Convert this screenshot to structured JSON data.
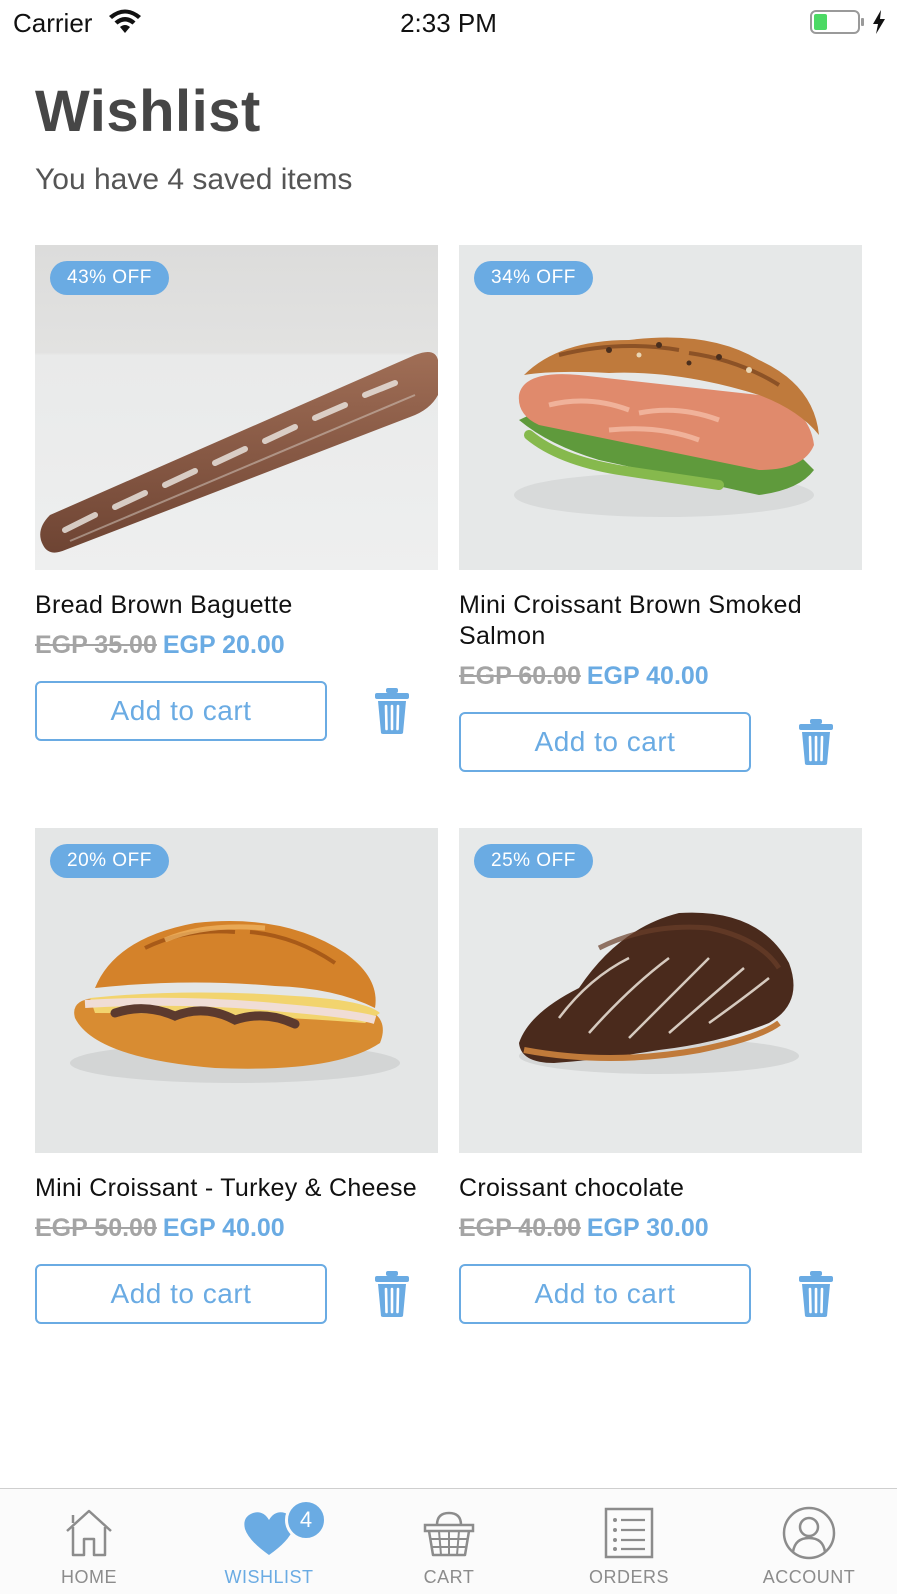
{
  "status_bar": {
    "carrier": "Carrier",
    "time": "2:33 PM"
  },
  "header": {
    "title": "Wishlist",
    "subtitle": "You have 4 saved items"
  },
  "items": [
    {
      "discount": "43% OFF",
      "name": "Bread Brown Baguette",
      "old_price": "EGP 35.00",
      "new_price": "EGP 20.00",
      "add_label": "Add to cart"
    },
    {
      "discount": "34% OFF",
      "name": "Mini Croissant Brown Smoked Salmon",
      "old_price": "EGP 60.00",
      "new_price": "EGP 40.00",
      "add_label": "Add to cart"
    },
    {
      "discount": "20% OFF",
      "name": "Mini Croissant - Turkey & Cheese",
      "old_price": "EGP 50.00",
      "new_price": "EGP 40.00",
      "add_label": "Add to cart"
    },
    {
      "discount": "25% OFF",
      "name": "Croissant chocolate",
      "old_price": "EGP 40.00",
      "new_price": "EGP 30.00",
      "add_label": "Add to cart"
    }
  ],
  "tab_bar": {
    "tabs": [
      {
        "label": "HOME",
        "icon": "home-icon"
      },
      {
        "label": "WISHLIST",
        "icon": "heart-icon",
        "badge": "4",
        "active": true
      },
      {
        "label": "CART",
        "icon": "basket-icon"
      },
      {
        "label": "ORDERS",
        "icon": "list-icon"
      },
      {
        "label": "ACCOUNT",
        "icon": "user-icon"
      }
    ]
  },
  "colors": {
    "accent": "#6aabe3",
    "title": "#464646",
    "strike_price": "#a4a4a4"
  }
}
